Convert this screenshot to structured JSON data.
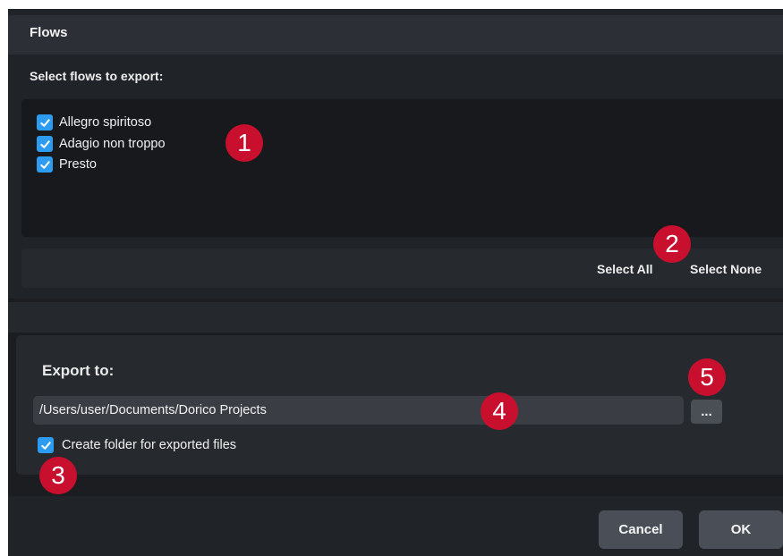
{
  "flows": {
    "title": "Flows",
    "sublabel": "Select flows to export:",
    "items": [
      {
        "label": "Allegro spiritoso",
        "checked": true
      },
      {
        "label": "Adagio non troppo",
        "checked": true
      },
      {
        "label": "Presto",
        "checked": true
      }
    ],
    "select_all": "Select All",
    "select_none": "Select None"
  },
  "export": {
    "title": "Export to:",
    "path": "/Users/user/Documents/Dorico Projects",
    "browse_label": "...",
    "create_folder_label": "Create folder for exported files",
    "create_folder_checked": true
  },
  "buttons": {
    "cancel": "Cancel",
    "ok": "OK"
  },
  "callouts": [
    "1",
    "2",
    "3",
    "4",
    "5"
  ],
  "colors": {
    "checkbox": "#2d9cf0",
    "callout": "#c8102e",
    "background": "#1b1d21"
  }
}
